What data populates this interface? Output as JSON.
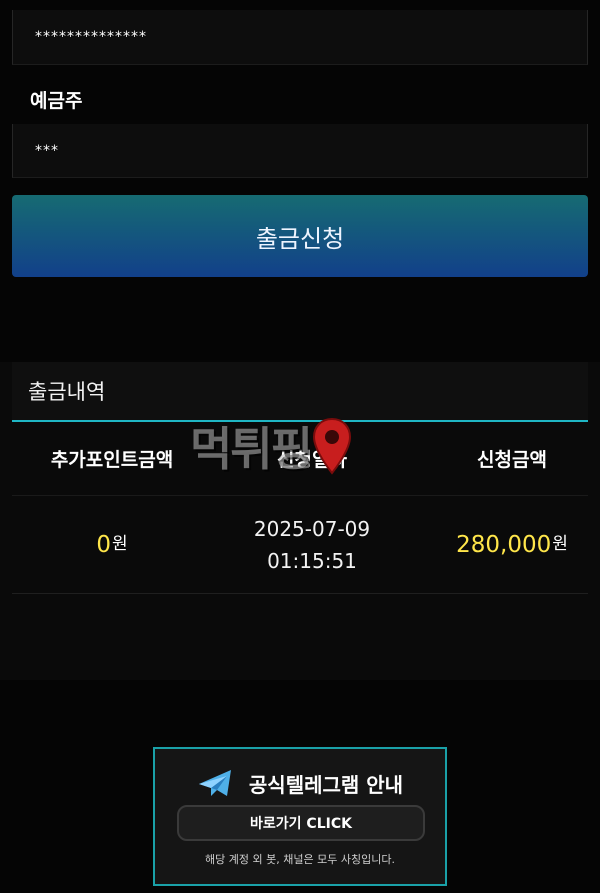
{
  "form": {
    "account_value": "**************",
    "holder_label": "예금주",
    "holder_value": "***",
    "submit_label": "출금신청"
  },
  "history": {
    "title": "출금내역",
    "columns": [
      "추가포인트금액",
      "신청일자",
      "신청금액"
    ],
    "rows": [
      {
        "bonus_amount": "0",
        "bonus_unit": "원",
        "date": "2025-07-09",
        "time": "01:15:51",
        "amount": "280,000",
        "amount_unit": "원"
      }
    ]
  },
  "watermark": {
    "text": "먹튀핑"
  },
  "banner": {
    "title": "공식텔레그램 안내",
    "button_label": "바로가기 CLICK",
    "note": "해당 계정 외 봇, 채널은 모두 사칭입니다."
  },
  "icons": [
    "telegram-icon",
    "location-pin-icon"
  ],
  "colors": {
    "accent": "#1fb6c4",
    "button_gradient_top": "#166b72",
    "button_gradient_bottom": "#12408a",
    "amount": "#ffe64a",
    "watermark_pin": "#d22020"
  }
}
